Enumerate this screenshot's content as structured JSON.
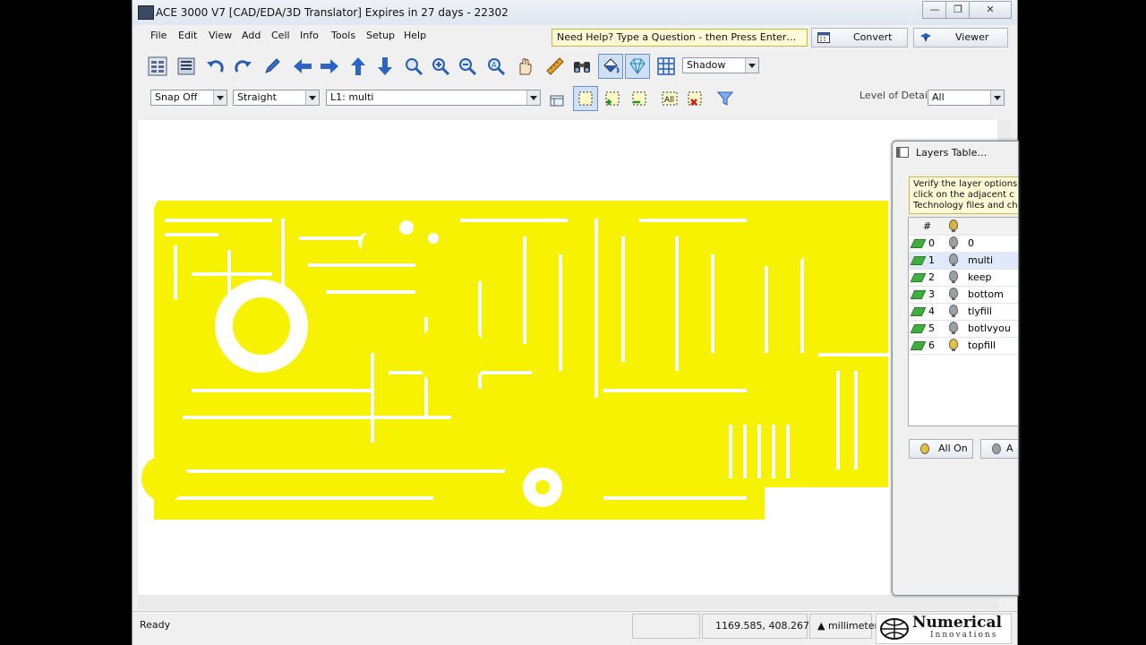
{
  "window": {
    "title": "ACE 3000 V7 [CAD/EDA/3D Translator]  Expires in 27 days  -  22302",
    "minimize": "—",
    "restore": "❐",
    "close": "✕"
  },
  "menu": [
    "File",
    "Edit",
    "View",
    "Add",
    "Cell",
    "Info",
    "Tools",
    "Setup",
    "Help"
  ],
  "help_box": "Need Help?  Type a Question - then Press Enter…",
  "convert_label": "Convert",
  "viewer_label": "Viewer",
  "toolbar1": {
    "icons": [
      "layer-manager-icon",
      "layer-list-icon",
      "undo-icon",
      "redo-icon",
      "edit-pen-icon",
      "arrow-left-icon",
      "arrow-right-icon",
      "arrow-up-icon",
      "arrow-down-icon",
      "zoom-icon",
      "zoom-in-icon",
      "zoom-out-icon",
      "zoom-fit-icon",
      "pan-hand-icon",
      "ruler-icon",
      "binoculars-icon",
      "paint-bucket-icon",
      "gem-icon",
      "grid-icon"
    ],
    "shadow_value": "Shadow"
  },
  "toolbar2": {
    "snap_value": "Snap Off",
    "line_value": "Straight",
    "layer_value": "L1: multi",
    "lod_label": "Level of Detail:",
    "lod_value": "All"
  },
  "status": {
    "text": "Ready",
    "coords": "1169.585, 408.267",
    "units": "millimeter",
    "logo_top": "Numerical",
    "logo_bottom": "Innovations"
  },
  "layers_panel": {
    "title": "Layers Table…",
    "hint_lines": [
      "Verify the layer options",
      "click on the adjacent c",
      "Technology files and ch"
    ],
    "col_num": "#",
    "rows": [
      {
        "num": "0",
        "name": "0"
      },
      {
        "num": "1",
        "name": "multi"
      },
      {
        "num": "2",
        "name": "keep"
      },
      {
        "num": "3",
        "name": "bottom"
      },
      {
        "num": "4",
        "name": "tlyfill"
      },
      {
        "num": "5",
        "name": "botlvyou"
      },
      {
        "num": "6",
        "name": "topfill"
      }
    ],
    "all_on": "All On",
    "all_btn2": "A"
  },
  "colors": {
    "pcb": "#f6f200",
    "accent": "#2a5db0"
  }
}
